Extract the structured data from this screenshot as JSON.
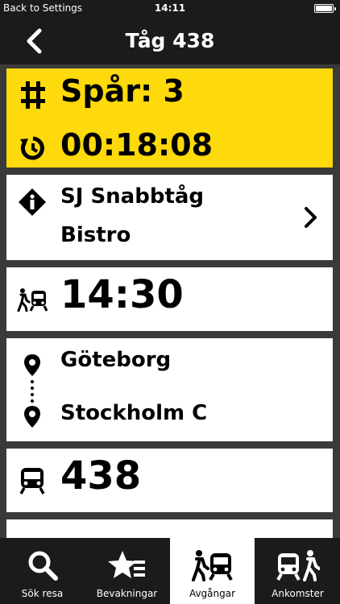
{
  "status_bar": {
    "back_label": "Back to Settings",
    "time": "14:11"
  },
  "nav": {
    "title": "Tåg 438"
  },
  "track_card": {
    "track": "Spår: 3",
    "countdown": "00:18:08"
  },
  "info_card": {
    "line1": "SJ Snabbtåg",
    "line2": "Bistro"
  },
  "departure_card": {
    "time": "14:30"
  },
  "route_card": {
    "from": "Göteborg",
    "to": "Stockholm C"
  },
  "train_card": {
    "number": "438"
  },
  "tabs": [
    {
      "label": "Sök resa",
      "icon": "search-icon"
    },
    {
      "label": "Bevakningar",
      "icon": "star-list-icon"
    },
    {
      "label": "Avgångar",
      "icon": "walk-train-icon"
    },
    {
      "label": "Ankomster",
      "icon": "train-walk-icon"
    }
  ],
  "colors": {
    "accent": "#fed90b",
    "bar": "#1b1b1b",
    "background": "#3a3a3a"
  }
}
